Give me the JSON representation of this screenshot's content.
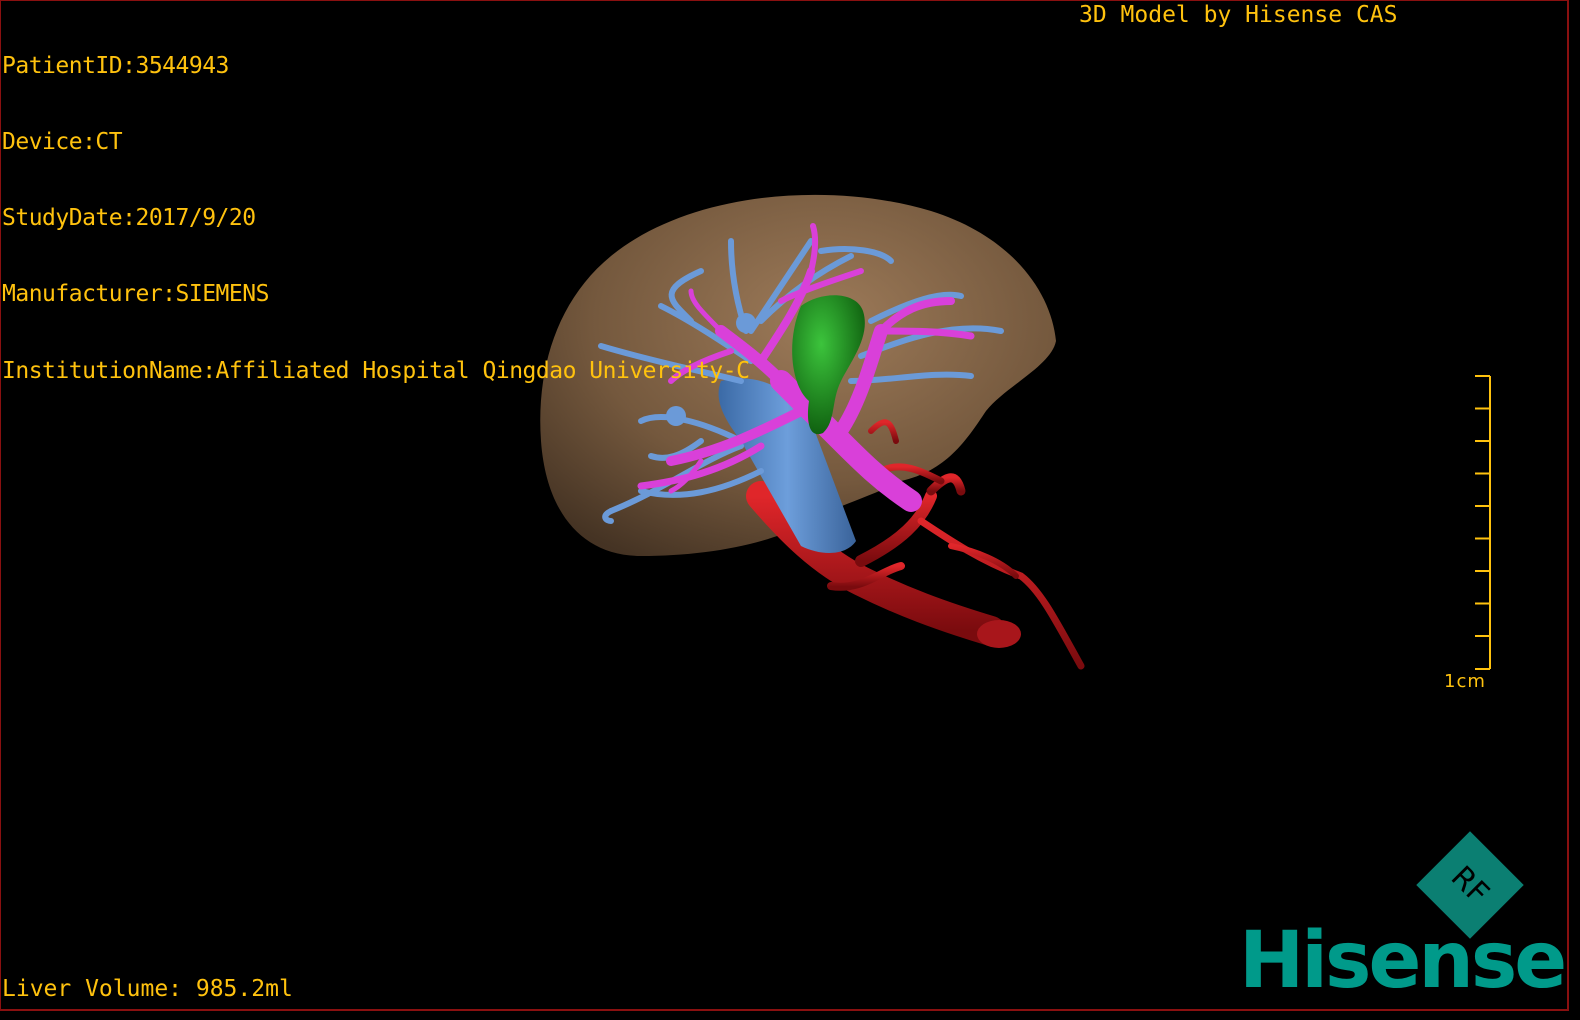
{
  "overlay": {
    "patient_id": "PatientID:3544943",
    "device": "Device:CT",
    "study_date": "StudyDate:2017/9/20",
    "manufacturer": "Manufacturer:SIEMENS",
    "institution": "InstitutionName:Affiliated Hospital Qingdao University-C",
    "credit": "3D Model by Hisense CAS",
    "liver_volume": "Liver Volume: 985.2ml"
  },
  "scale_bar": {
    "label": "1cm",
    "color": "#ffc20e"
  },
  "logo": {
    "badge_text": "RF",
    "brand": "Hisense",
    "color": "#009a8a"
  },
  "render": {
    "structures": [
      "liver",
      "portal-vein",
      "hepatic-vein",
      "hepatic-artery",
      "gallbladder",
      "inferior-vena-cava"
    ],
    "colors": {
      "liver": "#8a6a48",
      "hepatic-vein": "#5b8fd6",
      "portal-vein": "#d43fd4",
      "hepatic-artery": "#c0151a",
      "gallbladder": "#1e8a1e",
      "ivc": "#4f7fb8"
    }
  }
}
